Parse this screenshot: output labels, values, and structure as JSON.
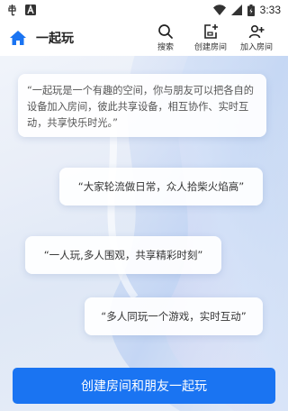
{
  "status_bar": {
    "time": "3:33",
    "icons": [
      "app-notification-icon",
      "text-notification-icon",
      "wifi-icon",
      "signal-icon",
      "battery-icon"
    ]
  },
  "header": {
    "title": "一起玩",
    "actions": [
      {
        "label": "搜索",
        "icon": "search-icon"
      },
      {
        "label": "创建房间",
        "icon": "create-room-icon"
      },
      {
        "label": "加入房间",
        "icon": "join-room-icon"
      }
    ]
  },
  "intro": "“一起玩是一个有趣的空间，你与朋友可以把各自的设备加入房间，彼此共享设备，相互协作、实时互动，共享快乐时光。”",
  "quotes": [
    "“大家轮流做日常，众人拾柴火焰高”",
    "“一人玩,多人围观，共享精彩时刻”",
    "“多人同玩一个游戏，实时互动”"
  ],
  "create_button": "创建房间和朋友一起玩",
  "colors": {
    "accent": "#1a74f2",
    "background": "#e9eef8"
  }
}
